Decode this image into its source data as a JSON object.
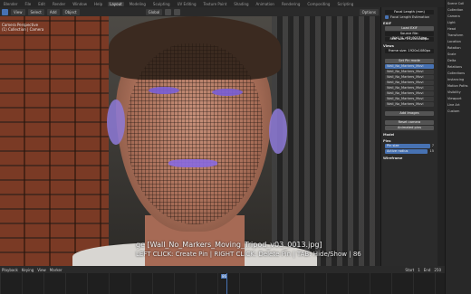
{
  "menubar": {
    "menus": [
      "Blender",
      "File",
      "Edit",
      "Render",
      "Window",
      "Help"
    ],
    "workspaces": [
      "Layout",
      "Modeling",
      "Sculpting",
      "UV Editing",
      "Texture Paint",
      "Shading",
      "Animation",
      "Rendering",
      "Compositing",
      "Scripting"
    ],
    "active_workspace": "Layout",
    "scene_label": "Scene"
  },
  "header": {
    "view_menu": "View",
    "select_menu": "Select",
    "add_menu": "Add",
    "object_menu": "Object",
    "orientation": "Global",
    "options": "Options"
  },
  "viewport": {
    "overlay_text_1": "Camera Perspective",
    "overlay_text_2": "(1) Collection | Camera",
    "image_name": "ge [Wall_No_Markers_Moving_Tripod_v03_0013.jpg]",
    "hint": "LEFT CLICK: Create Pin | RIGHT CLICK: Delete Pin | TAB: Hide/Show | 86"
  },
  "npanel": {
    "focal_label": "Focal Length (mm)",
    "focal_value": "Focal Length Estimation",
    "exif_label": "EXIF",
    "exif_value": "Load EXIF",
    "source_file": "Source file: Wall_N_v03_0013.jpg",
    "real_size": "Real size: 1920x1080px",
    "views_label": "Views",
    "frame_size": "Frame size: 1920x1080px",
    "clip_label": "Set Pin mode",
    "clips": [
      "Wall_No_Markers_Movi",
      "Wall_No_Markers_Movi",
      "Wall_No_Markers_Movi",
      "Wall_No_Markers_Movi",
      "Wall_No_Markers_Movi",
      "Wall_No_Markers_Movi",
      "Wall_No_Markers_Movi",
      "Wall_No_Markers_Movi"
    ],
    "add_images": "Add Images",
    "reset_camera": "Reset camera",
    "animated_pins": "Animated pins",
    "model_label": "Model",
    "pins_label": "Pins",
    "pin_size": "Pin size",
    "pin_size_value": "7",
    "active_radius": "Active radius",
    "active_radius_value": "15",
    "wireframe_label": "Wireframe"
  },
  "outliner": {
    "items": [
      "Scene Coll",
      "Collection",
      "Camera",
      "Light",
      "Head",
      "Transform",
      "Location",
      "Rotation",
      "Scale",
      "Delta",
      "Relations",
      "Collections",
      "Instancing",
      "Motion Paths",
      "Visibility",
      "Viewport",
      "Line Art",
      "Custom"
    ]
  },
  "timeline": {
    "playback": "Playback",
    "keying": "Keying",
    "view": "View",
    "marker": "Marker",
    "start_label": "Start",
    "start_value": "1",
    "end_label": "End",
    "end_value": "250",
    "current_frame": "86"
  }
}
